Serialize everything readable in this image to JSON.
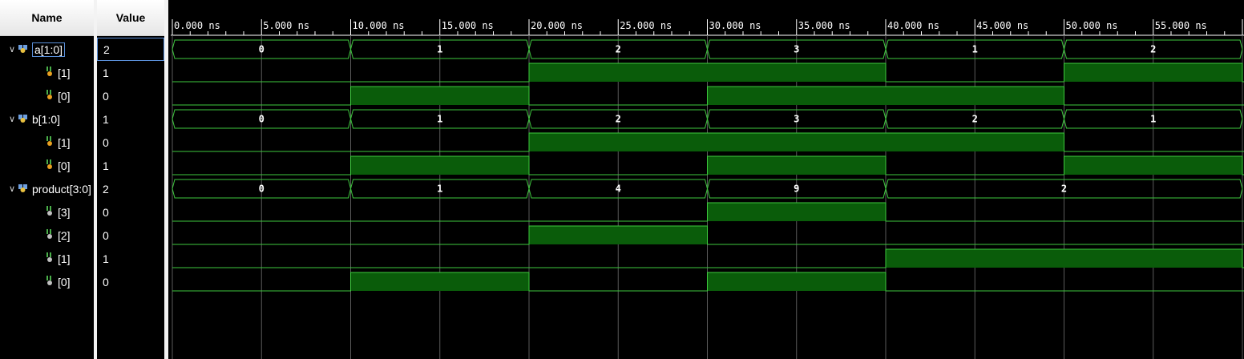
{
  "headers": {
    "name": "Name",
    "value": "Value"
  },
  "time_axis": {
    "ticks": [
      "0.000 ns",
      "5.000 ns",
      "10.000 ns",
      "15.000 ns",
      "20.000 ns",
      "25.000 ns",
      "30.000 ns",
      "35.000 ns",
      "40.000 ns",
      "45.000 ns",
      "50.000 ns",
      "55.000 ns"
    ]
  },
  "signals": [
    {
      "name": "a[1:0]",
      "value": "2",
      "type": "bus",
      "expanded": true,
      "selected": true,
      "segments": [
        {
          "t0": 0,
          "t1": 10,
          "label": "0"
        },
        {
          "t0": 10,
          "t1": 20,
          "label": "1"
        },
        {
          "t0": 20,
          "t1": 30,
          "label": "2"
        },
        {
          "t0": 30,
          "t1": 40,
          "label": "3"
        },
        {
          "t0": 40,
          "t1": 50,
          "label": "1"
        },
        {
          "t0": 50,
          "t1": 60,
          "label": "2"
        }
      ]
    },
    {
      "name": "[1]",
      "value": "1",
      "type": "bit",
      "icon": "input",
      "high": [
        [
          20,
          40
        ],
        [
          50,
          60
        ]
      ]
    },
    {
      "name": "[0]",
      "value": "0",
      "type": "bit",
      "icon": "input",
      "high": [
        [
          10,
          20
        ],
        [
          30,
          50
        ]
      ]
    },
    {
      "name": "b[1:0]",
      "value": "1",
      "type": "bus",
      "expanded": true,
      "segments": [
        {
          "t0": 0,
          "t1": 10,
          "label": "0"
        },
        {
          "t0": 10,
          "t1": 20,
          "label": "1"
        },
        {
          "t0": 20,
          "t1": 30,
          "label": "2"
        },
        {
          "t0": 30,
          "t1": 40,
          "label": "3"
        },
        {
          "t0": 40,
          "t1": 50,
          "label": "2"
        },
        {
          "t0": 50,
          "t1": 60,
          "label": "1"
        }
      ]
    },
    {
      "name": "[1]",
      "value": "0",
      "type": "bit",
      "icon": "input",
      "high": [
        [
          20,
          50
        ]
      ]
    },
    {
      "name": "[0]",
      "value": "1",
      "type": "bit",
      "icon": "input",
      "high": [
        [
          10,
          20
        ],
        [
          30,
          40
        ],
        [
          50,
          60
        ]
      ]
    },
    {
      "name": "product[3:0]",
      "value": "2",
      "type": "bus",
      "expanded": true,
      "segments": [
        {
          "t0": 0,
          "t1": 10,
          "label": "0"
        },
        {
          "t0": 10,
          "t1": 20,
          "label": "1"
        },
        {
          "t0": 20,
          "t1": 30,
          "label": "4"
        },
        {
          "t0": 30,
          "t1": 40,
          "label": "9"
        },
        {
          "t0": 40,
          "t1": 60,
          "label": "2"
        }
      ]
    },
    {
      "name": "[3]",
      "value": "0",
      "type": "bit",
      "icon": "output",
      "high": [
        [
          30,
          40
        ]
      ]
    },
    {
      "name": "[2]",
      "value": "0",
      "type": "bit",
      "icon": "output",
      "high": [
        [
          20,
          30
        ]
      ]
    },
    {
      "name": "[1]",
      "value": "1",
      "type": "bit",
      "icon": "output",
      "high": [
        [
          40,
          60
        ]
      ]
    },
    {
      "name": "[0]",
      "value": "0",
      "type": "bit",
      "icon": "output",
      "high": [
        [
          10,
          20
        ],
        [
          30,
          40
        ]
      ]
    }
  ],
  "colors": {
    "wave": "#3ec83e",
    "fill": "#0a5c0a",
    "grid": "#5a5a5a",
    "text": "#ffffff",
    "bg": "#000000"
  }
}
